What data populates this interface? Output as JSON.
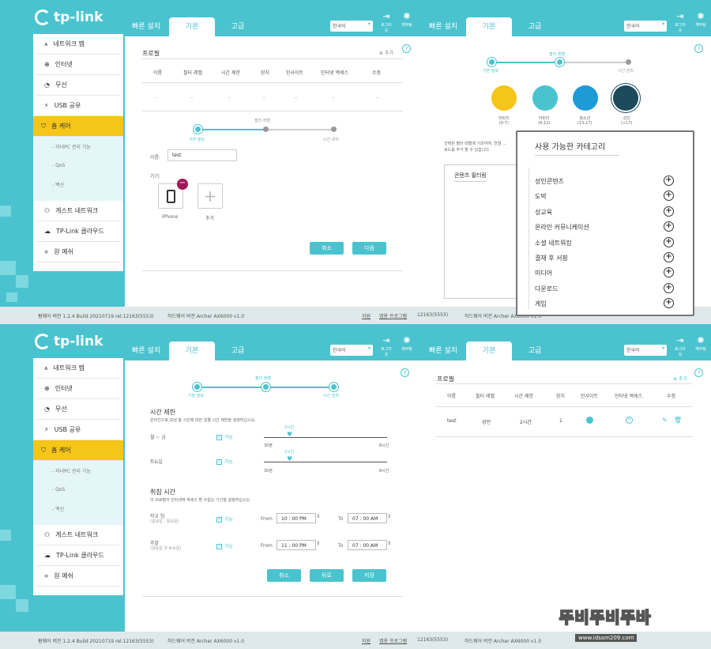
{
  "colors": {
    "accent": "#4ac3cf",
    "active_nav": "#f5c518",
    "child": "#f5c518",
    "preteen": "#4ac3cf",
    "teen": "#1e9bd7",
    "adult": "#1b4a5a",
    "remove": "#a01858"
  },
  "brand": "tp-link",
  "tabs": {
    "quick": "빠른 설치",
    "basic": "기본",
    "advanced": "고급"
  },
  "lang": "한국어",
  "top_icons": {
    "logout": "로그아웃",
    "reboot": "재부팅"
  },
  "sidebar": [
    {
      "label": "네트워크 맵",
      "icon": "network-map-icon"
    },
    {
      "label": "인터넷",
      "icon": "globe-icon"
    },
    {
      "label": "무선",
      "icon": "wifi-icon"
    },
    {
      "label": "USB 공유",
      "icon": "usb-icon"
    },
    {
      "label": "홈 케어",
      "icon": "shield-icon"
    },
    {
      "label": "게스트 네트워크",
      "icon": "guest-icon"
    },
    {
      "label": "TP-Link 클라우드",
      "icon": "cloud-icon"
    },
    {
      "label": "원 메쉬",
      "icon": "mesh-icon"
    }
  ],
  "subitems": [
    "- 자녀PC 관리 기능",
    "- QoS",
    "- 백신"
  ],
  "footer": {
    "firmware": "펌웨어 버전 1.2.4 Build 20210719 rel.12163(5553)",
    "fw_tail": "12163(5553)",
    "hardware": "하드웨어 버전 Archer AX6000 v1.0",
    "support": "지원",
    "app": "앱용 프로그램"
  },
  "profile": {
    "title": "프로필",
    "add": "추가",
    "cols": [
      "이름",
      "필터 레벨",
      "시간 제한",
      "장치",
      "인사이트",
      "인터넷 액세스",
      "수정"
    ],
    "empty": "--",
    "row": {
      "name": "test",
      "level": "성인",
      "time": "2시간",
      "devices": "1"
    }
  },
  "wizard": {
    "steps": [
      "기본 정보",
      "필터 레벨",
      "시간 관리"
    ]
  },
  "basic_form": {
    "name_label": "이름:",
    "name_value": "test",
    "devices_label": "기기:",
    "device_name": "iPhone",
    "add_label": "추가",
    "cancel": "취소",
    "next": "다음"
  },
  "filter": {
    "ages": [
      {
        "label": "어린이",
        "range": "(0-7)"
      },
      {
        "label": "어린이",
        "range": "(8-12)"
      },
      {
        "label": "청소년",
        "range": "(13-17)"
      },
      {
        "label": "성인",
        "range": "(>17)"
      }
    ],
    "desc": "선택된 필터 레벨에 기초하여, 연결 ...",
    "desc2": "워드를 추가 할 수 있습니다.",
    "content_filter": "콘텐츠 필터링"
  },
  "popup": {
    "title": "사용 가능한 카테고리",
    "items": [
      "성인콘텐츠",
      "도박",
      "성교육",
      "온라인 커뮤니케이션",
      "소셜 네트워킹",
      "결재 후 서핑",
      "미디어",
      "다운로드",
      "게임"
    ]
  },
  "time": {
    "limit_title": "시간 제한",
    "limit_desc": "온라인으로 보낸 총 시간에 대한 일별 시간 제한을 설정하십시오.",
    "weekday": "월 ~ 금",
    "weekend": "토&일",
    "enabled": "가능",
    "min": "30분",
    "max": "8시간",
    "value": "2시간",
    "bed_title": "취침 시간",
    "bed_desc": "이 프로필의 인터넷에 액세스 할 수없는 기간을 설정하십시오.",
    "school_night": "학교 밤",
    "school_sub": "(일요일 - 목요일)",
    "weekend_night": "주말",
    "weekend_sub": "(금요일 과 토요일)",
    "from": "From",
    "to": "To",
    "school_from": "10 : 00 PM",
    "school_to": "07 : 00 AM",
    "weekend_from": "11 : 00 PM",
    "weekend_to": "07 : 00 AM",
    "cancel": "취소",
    "back": "뒤로",
    "save": "저장"
  },
  "watermark": {
    "brand": "뚜비뚜비뚜바",
    "url": "www.idsam209.com"
  }
}
